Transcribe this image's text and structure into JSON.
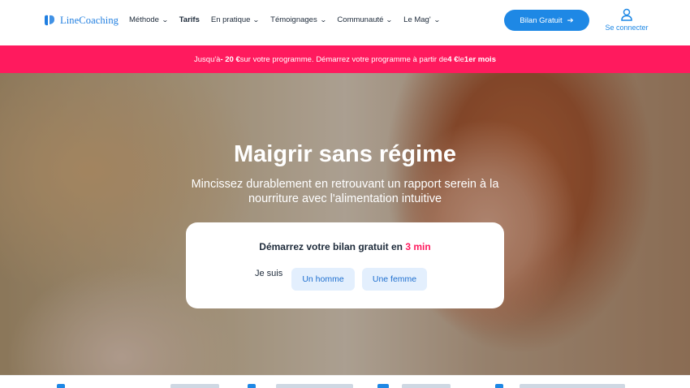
{
  "brand": {
    "name": "LineCoaching",
    "color": "#1f7ee0"
  },
  "nav": [
    {
      "label": "Méthode",
      "dropdown": true,
      "bold": false
    },
    {
      "label": "Tarifs",
      "dropdown": false,
      "bold": true
    },
    {
      "label": "En pratique",
      "dropdown": true,
      "bold": false
    },
    {
      "label": "Témoignages",
      "dropdown": true,
      "bold": false
    },
    {
      "label": "Communauté",
      "dropdown": true,
      "bold": false
    },
    {
      "label": "Le Mag'",
      "dropdown": true,
      "bold": false
    }
  ],
  "header": {
    "cta_label": "Bilan Gratuit",
    "cta_icon": "arrow-right-icon",
    "login_label": "Se connecter",
    "login_icon": "user-icon"
  },
  "promo": {
    "p1": "Jusqu'à ",
    "b1": "- 20 €",
    "p2": " sur votre programme. Démarrez votre programme à partir de ",
    "b2": "4 €",
    "p3": " le ",
    "b3": "1er mois"
  },
  "hero": {
    "title": "Maigrir sans régime",
    "subtitle": "Mincissez durablement en retrouvant un rapport serein à la nourriture avec l'alimentation intuitive"
  },
  "card": {
    "title_prefix": "Démarrez votre bilan gratuit en ",
    "title_accent": "3 min",
    "gender_label": "Je suis",
    "option_man": "Un homme",
    "option_woman": "Une femme"
  },
  "colors": {
    "primary": "#1e88e5",
    "promo": "#ff1a5e",
    "accent": "#ff1a5e"
  }
}
